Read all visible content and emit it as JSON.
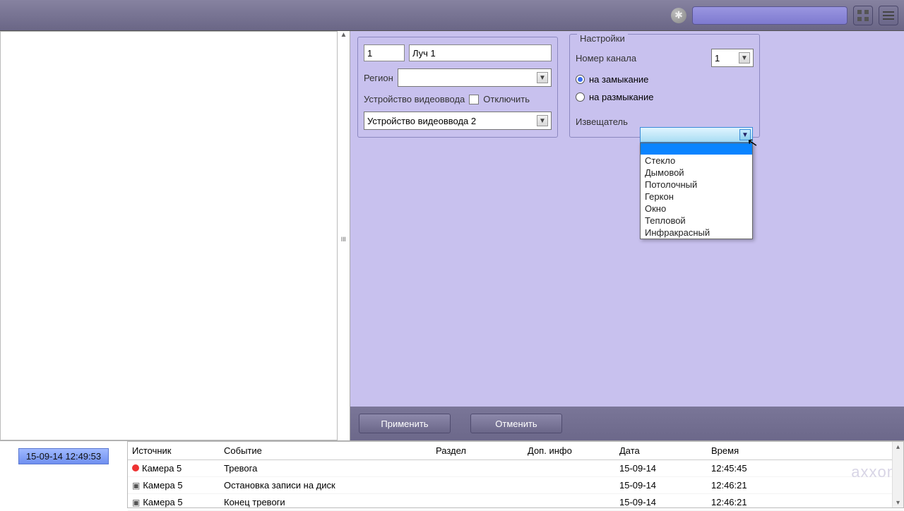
{
  "topbar": {},
  "form": {
    "id_value": "1",
    "name_value": "Луч 1",
    "region_label": "Регион",
    "region_value": "",
    "device_label": "Устройство видеоввода",
    "disable_label": "Отключить",
    "device_value": "Устройство видеоввода 2"
  },
  "settings": {
    "legend": "Настройки",
    "channel_label": "Номер канала",
    "channel_value": "1",
    "closing_label": "на замыкание",
    "opening_label": "на размыкание",
    "detector_label": "Извещатель",
    "detector_options": [
      "",
      "Стекло",
      "Дымовой",
      "Потолочный",
      "Геркон",
      "Окно",
      "Тепловой",
      "Инфракрасный"
    ]
  },
  "buttons": {
    "apply": "Применить",
    "cancel": "Отменить"
  },
  "clock": "15-09-14   12:49:53",
  "log": {
    "headers": {
      "src": "Источник",
      "evt": "Событие",
      "sec": "Раздел",
      "info": "Доп. инфо",
      "date": "Дата",
      "time": "Время"
    },
    "rows": [
      {
        "icon": "rec",
        "src": "Камера 5",
        "evt": "Тревога",
        "date": "15-09-14",
        "time": "12:45:45"
      },
      {
        "icon": "cam",
        "src": "Камера 5",
        "evt": "Остановка записи на диск",
        "date": "15-09-14",
        "time": "12:46:21"
      },
      {
        "icon": "cam",
        "src": "Камера 5",
        "evt": "Конец тревоги",
        "date": "15-09-14",
        "time": "12:46:21"
      }
    ]
  },
  "watermark": "axxon"
}
